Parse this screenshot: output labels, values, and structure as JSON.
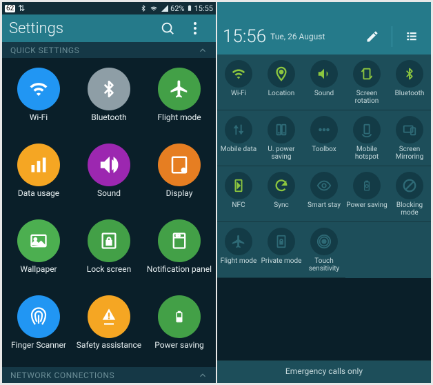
{
  "leftPhone": {
    "status": {
      "batteryBadge": "62",
      "batteryPct": "62%",
      "time": "15:55"
    },
    "title": "Settings",
    "sections": {
      "quick": "QUICK SETTINGS",
      "network": "NETWORK CONNECTIONS"
    },
    "items": [
      {
        "label": "Wi-Fi",
        "icon": "wifi",
        "color": "#2196f3"
      },
      {
        "label": "Bluetooth",
        "icon": "bt",
        "color": "#8e9ea6"
      },
      {
        "label": "Flight mode",
        "icon": "airplane",
        "color": "#43a047"
      },
      {
        "label": "Data usage",
        "icon": "bars",
        "color": "#f5a623"
      },
      {
        "label": "Sound",
        "icon": "sound",
        "color": "#9c27b0"
      },
      {
        "label": "Display",
        "icon": "display",
        "color": "#e67e22"
      },
      {
        "label": "Wallpaper",
        "icon": "wallpaper",
        "color": "#4caf50"
      },
      {
        "label": "Lock screen",
        "icon": "lock",
        "color": "#43a047"
      },
      {
        "label": "Notification panel",
        "icon": "notif",
        "color": "#43a047"
      },
      {
        "label": "Finger Scanner",
        "icon": "finger",
        "color": "#2196f3"
      },
      {
        "label": "Safety assistance",
        "icon": "safety",
        "color": "#f5a623"
      },
      {
        "label": "Power saving",
        "icon": "battery",
        "color": "#43a047"
      }
    ]
  },
  "rightPhone": {
    "header": {
      "time": "15:56",
      "date": "Tue, 26 August"
    },
    "toggles": [
      {
        "label": "Wi-Fi",
        "icon": "wifi",
        "on": true
      },
      {
        "label": "Location",
        "icon": "location",
        "on": true
      },
      {
        "label": "Sound",
        "icon": "sound",
        "on": true
      },
      {
        "label": "Screen rotation",
        "icon": "rotate",
        "on": true
      },
      {
        "label": "Bluetooth",
        "icon": "bt",
        "on": true
      },
      {
        "label": "Mobile data",
        "icon": "mdata",
        "on": false
      },
      {
        "label": "U. power saving",
        "icon": "upsave",
        "on": false
      },
      {
        "label": "Toolbox",
        "icon": "toolbox",
        "on": false
      },
      {
        "label": "Mobile hotspot",
        "icon": "hotspot",
        "on": false
      },
      {
        "label": "Screen Mirroring",
        "icon": "mirror",
        "on": false
      },
      {
        "label": "NFC",
        "icon": "nfc",
        "on": true
      },
      {
        "label": "Sync",
        "icon": "sync",
        "on": true
      },
      {
        "label": "Smart stay",
        "icon": "eye",
        "on": false
      },
      {
        "label": "Power saving",
        "icon": "psave",
        "on": false
      },
      {
        "label": "Blocking mode",
        "icon": "block",
        "on": false
      },
      {
        "label": "Flight mode",
        "icon": "airplane",
        "on": false
      },
      {
        "label": "Private mode",
        "icon": "private",
        "on": false
      },
      {
        "label": "Touch sensitivity",
        "icon": "touch",
        "on": false
      }
    ],
    "footer": "Emergency calls only"
  }
}
